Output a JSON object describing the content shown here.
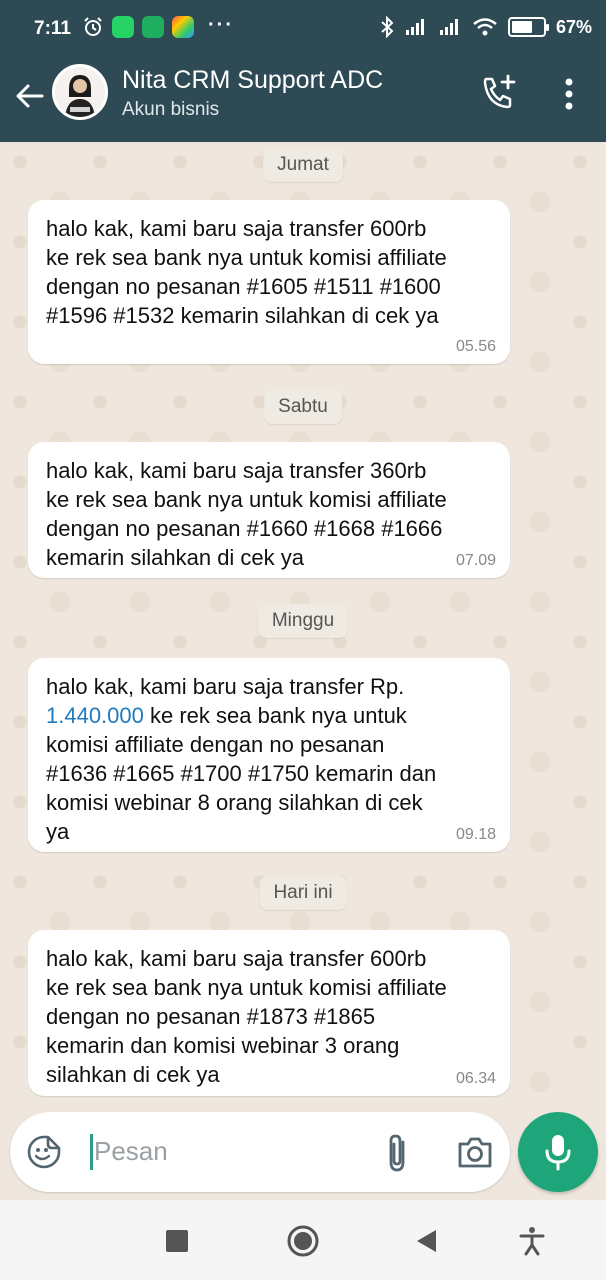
{
  "status_bar": {
    "time": "7:11",
    "battery_percent_label": "67%",
    "battery_level": 0.67
  },
  "header": {
    "contact_name": "Nita CRM Support ADC",
    "subtitle": "Akun bisnis"
  },
  "messages": [
    {
      "date_label": "Jumat",
      "text": "halo kak, kami baru saja transfer 600rb\nke rek sea bank nya untuk komisi affiliate\ndengan no pesanan #1605 #1511 #1600\n#1596 #1532 kemarin silahkan di cek ya",
      "time": "05.56"
    },
    {
      "date_label": "Sabtu",
      "text": "halo kak, kami baru saja transfer 360rb\nke rek sea bank nya untuk komisi affiliate\ndengan no pesanan #1660 #1668 #1666\nkemarin silahkan di cek ya",
      "time": "07.09"
    },
    {
      "date_label": "Minggu",
      "text_before_link": "halo kak, kami baru saja transfer Rp.\n",
      "link_text": "1.440.000",
      "text_after_link": " ke rek sea bank nya untuk\nkomisi affiliate dengan no pesanan\n#1636 #1665 #1700 #1750 kemarin dan\nkomisi webinar 8 orang silahkan di cek\nya",
      "time": "09.18"
    },
    {
      "date_label": "Hari ini",
      "text": "halo kak, kami baru saja transfer 600rb\nke rek sea bank nya untuk komisi affiliate\ndengan no pesanan #1873 #1865\nkemarin dan komisi webinar 3 orang\nsilahkan di cek ya",
      "time": "06.34"
    }
  ],
  "composer": {
    "placeholder": "Pesan"
  },
  "colors": {
    "header_bg": "#2e4a55",
    "mic_button": "#1ea67a",
    "link": "#1f7bbf"
  }
}
